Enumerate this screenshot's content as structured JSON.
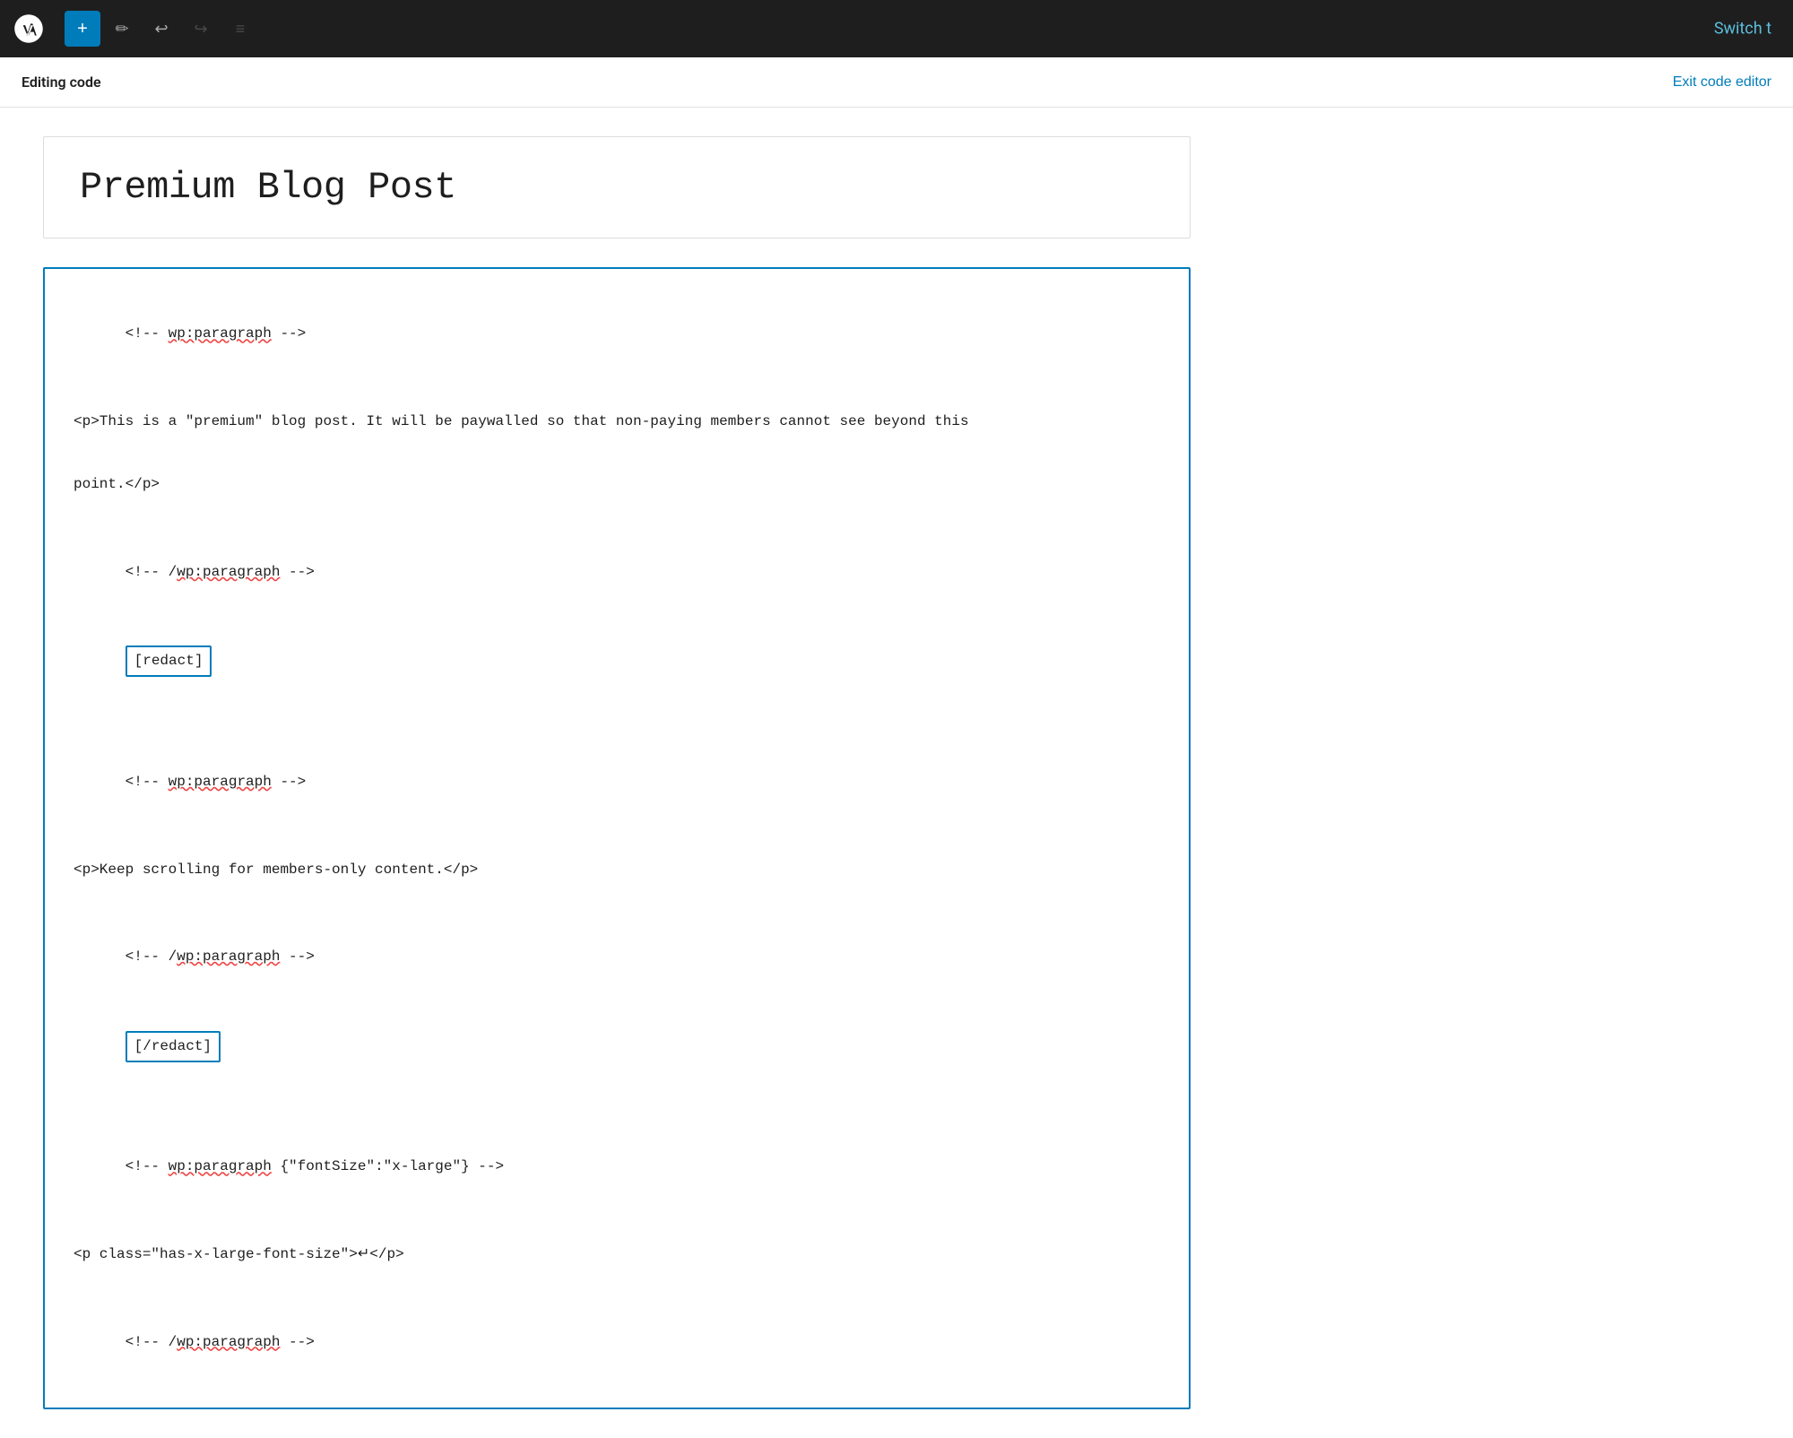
{
  "toolbar": {
    "add_button_label": "+",
    "switch_label": "Switch t",
    "undo_icon": "↩",
    "redo_icon": "↪",
    "edit_icon": "✏",
    "list_icon": "≡"
  },
  "secondary_bar": {
    "editing_code_label": "Editing code",
    "exit_code_editor_label": "Exit code editor"
  },
  "title_block": {
    "post_title": "Premium Blog Post"
  },
  "code_editor": {
    "lines": [
      {
        "type": "comment",
        "text": "<!-- ",
        "underline": "wp:paragraph",
        "text_after": " -->"
      },
      {
        "type": "empty"
      },
      {
        "type": "code",
        "text": "<p>This is a \"premium\" blog post. It will be paywalled so that non-paying members cannot see beyond this"
      },
      {
        "type": "empty"
      },
      {
        "type": "code",
        "text": "point.</p>"
      },
      {
        "type": "empty"
      },
      {
        "type": "comment",
        "text": "<!-- /",
        "underline": "wp:paragraph",
        "text_after": " -->"
      },
      {
        "type": "shortcode",
        "text": "[redact]"
      },
      {
        "type": "empty"
      },
      {
        "type": "comment",
        "text": "<!-- ",
        "underline": "wp:paragraph",
        "text_after": " -->"
      },
      {
        "type": "empty"
      },
      {
        "type": "code",
        "text": "<p>Keep scrolling for members-only content.</p>"
      },
      {
        "type": "empty"
      },
      {
        "type": "comment",
        "text": "<!-- /",
        "underline": "wp:paragraph",
        "text_after": " -->"
      },
      {
        "type": "shortcode",
        "text": "[/redact]"
      },
      {
        "type": "empty"
      },
      {
        "type": "comment_with_attr",
        "text": "<!-- ",
        "underline": "wp:paragraph",
        "attr": " {\"fontSize\":\"x-large\"}",
        "text_after": " -->"
      },
      {
        "type": "empty"
      },
      {
        "type": "code",
        "text": "<p class=\"has-x-large-font-size\">↵</p>"
      },
      {
        "type": "empty"
      },
      {
        "type": "comment",
        "text": "<!-- /",
        "underline": "wp:paragraph",
        "text_after": " -->"
      }
    ]
  }
}
